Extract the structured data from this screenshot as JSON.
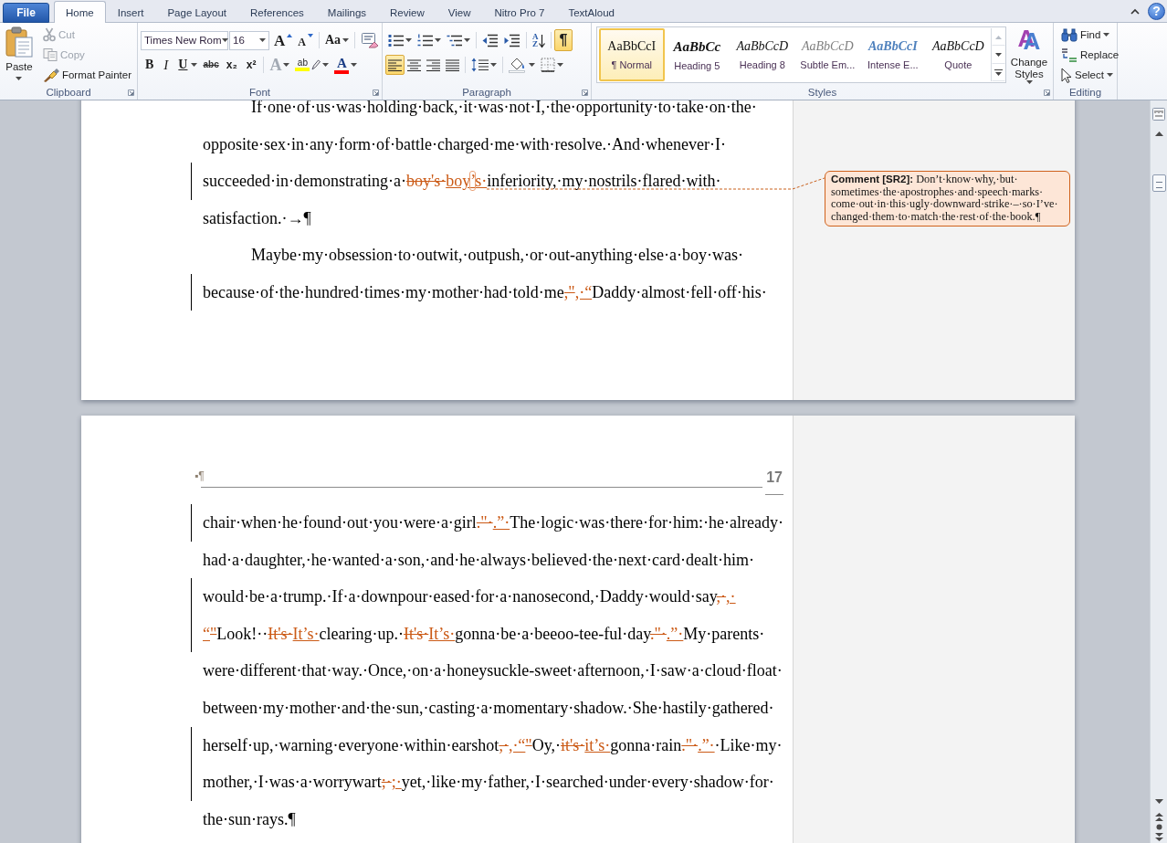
{
  "tab_bar": {
    "file_tab": "File",
    "tabs": [
      {
        "label": "Home",
        "selected": true
      },
      {
        "label": "Insert",
        "selected": false
      },
      {
        "label": "Page Layout",
        "selected": false
      },
      {
        "label": "References",
        "selected": false
      },
      {
        "label": "Mailings",
        "selected": false
      },
      {
        "label": "Review",
        "selected": false
      },
      {
        "label": "View",
        "selected": false
      },
      {
        "label": "Nitro Pro 7",
        "selected": false
      },
      {
        "label": "TextAloud",
        "selected": false
      }
    ],
    "help": "?"
  },
  "ribbon": {
    "clipboard": {
      "label": "Clipboard",
      "paste": "Paste",
      "commands": [
        {
          "kind": "cut",
          "label": "Cut",
          "disabled": true
        },
        {
          "kind": "copy",
          "label": "Copy",
          "disabled": true
        },
        {
          "kind": "format_painter",
          "label": "Format Painter",
          "disabled": false
        }
      ]
    },
    "font": {
      "label": "Font",
      "font_name": "Times New Rom",
      "font_size": "16",
      "row_1": [
        {
          "kind": "grow",
          "glyph": "A"
        },
        {
          "kind": "shrink",
          "glyph": "A"
        },
        {
          "kind": "change_case",
          "glyph": "Aa"
        },
        {
          "kind": "clear_formatting"
        }
      ],
      "row_2": [
        {
          "kind": "bold",
          "glyph": "B",
          "disabled": false
        },
        {
          "kind": "italic",
          "glyph": "I",
          "disabled": false
        },
        {
          "kind": "underline",
          "glyph": "U",
          "disabled": false
        },
        {
          "kind": "strikethrough",
          "glyph": "abc",
          "disabled": false
        },
        {
          "kind": "subscript",
          "glyph": "x₂",
          "disabled": false
        },
        {
          "kind": "superscript",
          "glyph": "x²",
          "disabled": false
        },
        {
          "kind": "text_effects",
          "glyph": "A",
          "disabled": true
        },
        {
          "kind": "highlight",
          "glyph": "ab",
          "disabled": false,
          "color": "#ffff00"
        },
        {
          "kind": "font_color",
          "glyph": "A",
          "disabled": false,
          "color": "#ff0000"
        }
      ]
    },
    "paragraph": {
      "label": "Paragraph",
      "row_1": [
        {
          "kind": "bullets",
          "selected": false
        },
        {
          "kind": "numbering",
          "selected": false
        },
        {
          "kind": "multilevel",
          "selected": false
        },
        {
          "kind": "decrease_indent",
          "selected": false
        },
        {
          "kind": "increase_indent",
          "selected": false
        },
        {
          "kind": "sort",
          "glyph": "AZ",
          "selected": false
        },
        {
          "kind": "show_marks",
          "glyph": "¶",
          "selected": true
        }
      ],
      "row_2": [
        {
          "kind": "align_left",
          "selected": true
        },
        {
          "kind": "center",
          "selected": false
        },
        {
          "kind": "align_right",
          "selected": false
        },
        {
          "kind": "justify",
          "selected": false
        },
        {
          "kind": "line_spacing",
          "selected": false
        },
        {
          "kind": "shading",
          "selected": false
        },
        {
          "kind": "borders",
          "selected": false
        }
      ]
    },
    "styles": {
      "label": "Styles",
      "gallery": [
        {
          "kind": "normal",
          "sample": "AaBbCcI",
          "name": "¶ Normal",
          "selected": true
        },
        {
          "kind": "heading_5",
          "sample": "AaBbCc",
          "name": "Heading 5",
          "selected": false
        },
        {
          "kind": "heading_8",
          "sample": "AaBbCcD",
          "name": "Heading 8",
          "selected": false
        },
        {
          "kind": "subtle_emphasis",
          "sample": "AaBbCcD",
          "name": "Subtle Em...",
          "selected": false
        },
        {
          "kind": "intense_emphasis",
          "sample": "AaBbCcI",
          "name": "Intense E...",
          "selected": false
        },
        {
          "kind": "quote",
          "sample": "AaBbCcD",
          "name": "Quote",
          "selected": false
        }
      ],
      "change_styles": {
        "glyph": "A",
        "label": "Change Styles"
      }
    },
    "editing": {
      "label": "Editing",
      "commands": [
        {
          "kind": "find",
          "label": "Find"
        },
        {
          "kind": "replace",
          "label": "Replace"
        },
        {
          "kind": "select",
          "label": "Select"
        }
      ]
    }
  },
  "document": {
    "pages": [
      {
        "lines": [
          {
            "first_line_indent": true,
            "changed": false,
            "segments": [
              {
                "kind": "plain",
                "text": "If·one·of·us·was·holding·back,·it·was·not·I,·the·opportunity·to·take·on·the·"
              }
            ]
          },
          {
            "first_line_indent": false,
            "changed": false,
            "segments": [
              {
                "kind": "plain",
                "text": "opposite·sex·in·any·form·of·battle·charged·me·with·resolve.·And·whenever·I·"
              }
            ]
          },
          {
            "first_line_indent": false,
            "changed": true,
            "segments": [
              {
                "kind": "plain",
                "text": "succeeded·in·demonstrating·a·"
              },
              {
                "kind": "deleted",
                "text": "boy's·"
              },
              {
                "kind": "inserted",
                "text": "boy"
              },
              {
                "kind": "inserted",
                "text": "’",
                "commented": true
              },
              {
                "kind": "inserted",
                "text": "s·"
              },
              {
                "kind": "plain",
                "text": "inferiority,·my·nostrils·flared·with·"
              }
            ]
          },
          {
            "first_line_indent": false,
            "changed": false,
            "segments": [
              {
                "kind": "plain",
                "text": "satisfaction.·→¶"
              }
            ]
          },
          {
            "first_line_indent": true,
            "changed": false,
            "segments": [
              {
                "kind": "plain",
                "text": "Maybe·my·obsession·to·outwit,·outpush,·or·out-anything·else·a·boy·was·"
              }
            ]
          },
          {
            "first_line_indent": false,
            "changed": true,
            "segments": [
              {
                "kind": "plain",
                "text": "because·of·the·hundred·times·my·mother·had·told·me"
              },
              {
                "kind": "deleted",
                "text": ",\""
              },
              {
                "kind": "inserted",
                "text": ",·“"
              },
              {
                "kind": "plain",
                "text": "Daddy·almost·fell·off·his·"
              }
            ]
          }
        ],
        "comments": [
          {
            "lines": [
              "**Comment [SR2]:** Don’t·know·why,·but·",
              "sometimes·the·apostrophes·and·speech·marks·",
              "come·out·in·this·ugly·downward·strike·–·so·I’ve·",
              "changed·them·to·match·the·rest·of·the·book.¶"
            ]
          }
        ]
      },
      {
        "header": {
          "marks": "▪¶",
          "page_number": "17"
        },
        "lines": [
          {
            "first_line_indent": false,
            "changed": true,
            "segments": [
              {
                "kind": "plain",
                "text": "chair·when·he·found·out·you·were·a·girl"
              },
              {
                "kind": "deleted",
                "text": ".\"·"
              },
              {
                "kind": "inserted",
                "text": ".”·"
              },
              {
                "kind": "plain",
                "text": "The·logic·was·there·for·him:·he·already·"
              }
            ]
          },
          {
            "first_line_indent": false,
            "changed": false,
            "segments": [
              {
                "kind": "plain",
                "text": "had·a·daughter,·he·wanted·a·son,·and·he·always·believed·the·next·card·dealt·him·"
              }
            ]
          },
          {
            "first_line_indent": false,
            "changed": true,
            "segments": [
              {
                "kind": "plain",
                "text": "would·be·a·trump.·If·a·downpour·eased·for·a·nanosecond,·Daddy·would·say"
              },
              {
                "kind": "deleted",
                "text": ",·"
              },
              {
                "kind": "inserted",
                "text": ",·"
              }
            ]
          },
          {
            "first_line_indent": false,
            "changed": true,
            "segments": [
              {
                "kind": "inserted",
                "text": "“"
              },
              {
                "kind": "deleted",
                "text": "\""
              },
              {
                "kind": "plain",
                "text": "Look!··"
              },
              {
                "kind": "deleted",
                "text": "It's·"
              },
              {
                "kind": "inserted",
                "text": "It’s·"
              },
              {
                "kind": "plain",
                "text": "clearing·up.·"
              },
              {
                "kind": "deleted",
                "text": "It's·"
              },
              {
                "kind": "inserted",
                "text": "It’s·"
              },
              {
                "kind": "plain",
                "text": "gonna·be·a·beeoo-tee-ful·day"
              },
              {
                "kind": "deleted",
                "text": ".\"·"
              },
              {
                "kind": "inserted",
                "text": ".”·"
              },
              {
                "kind": "plain",
                "text": "My·parents·"
              }
            ]
          },
          {
            "first_line_indent": false,
            "changed": false,
            "segments": [
              {
                "kind": "plain",
                "text": "were·different·that·way.·Once,·on·a·honeysuckle-sweet·afternoon,·I·saw·a·cloud·float·"
              }
            ]
          },
          {
            "first_line_indent": false,
            "changed": false,
            "segments": [
              {
                "kind": "plain",
                "text": "between·my·mother·and·the·sun,·casting·a·momentary·shadow.·She·hastily·gathered·"
              }
            ]
          },
          {
            "first_line_indent": false,
            "changed": true,
            "segments": [
              {
                "kind": "plain",
                "text": "herself·up,·warning·everyone·within·earshot"
              },
              {
                "kind": "deleted",
                "text": ",·"
              },
              {
                "kind": "inserted",
                "text": ",·“"
              },
              {
                "kind": "deleted",
                "text": "\""
              },
              {
                "kind": "plain",
                "text": "Oy,·"
              },
              {
                "kind": "deleted",
                "text": "it's·"
              },
              {
                "kind": "inserted",
                "text": "it’s·"
              },
              {
                "kind": "plain",
                "text": "gonna·rain"
              },
              {
                "kind": "deleted",
                "text": ".\"·"
              },
              {
                "kind": "inserted",
                "text": ".”·"
              },
              {
                "kind": "plain",
                "text": "·Like·my·"
              }
            ]
          },
          {
            "first_line_indent": false,
            "changed": true,
            "segments": [
              {
                "kind": "plain",
                "text": "mother,·I·was·a·worrywart"
              },
              {
                "kind": "deleted",
                "text": ";·"
              },
              {
                "kind": "inserted",
                "text": ";·"
              },
              {
                "kind": "plain",
                "text": "yet,·like·my·father,·I·searched·under·every·shadow·for·"
              }
            ]
          },
          {
            "first_line_indent": false,
            "changed": false,
            "segments": [
              {
                "kind": "plain",
                "text": "the·sun·rays.¶"
              }
            ]
          }
        ]
      }
    ]
  }
}
